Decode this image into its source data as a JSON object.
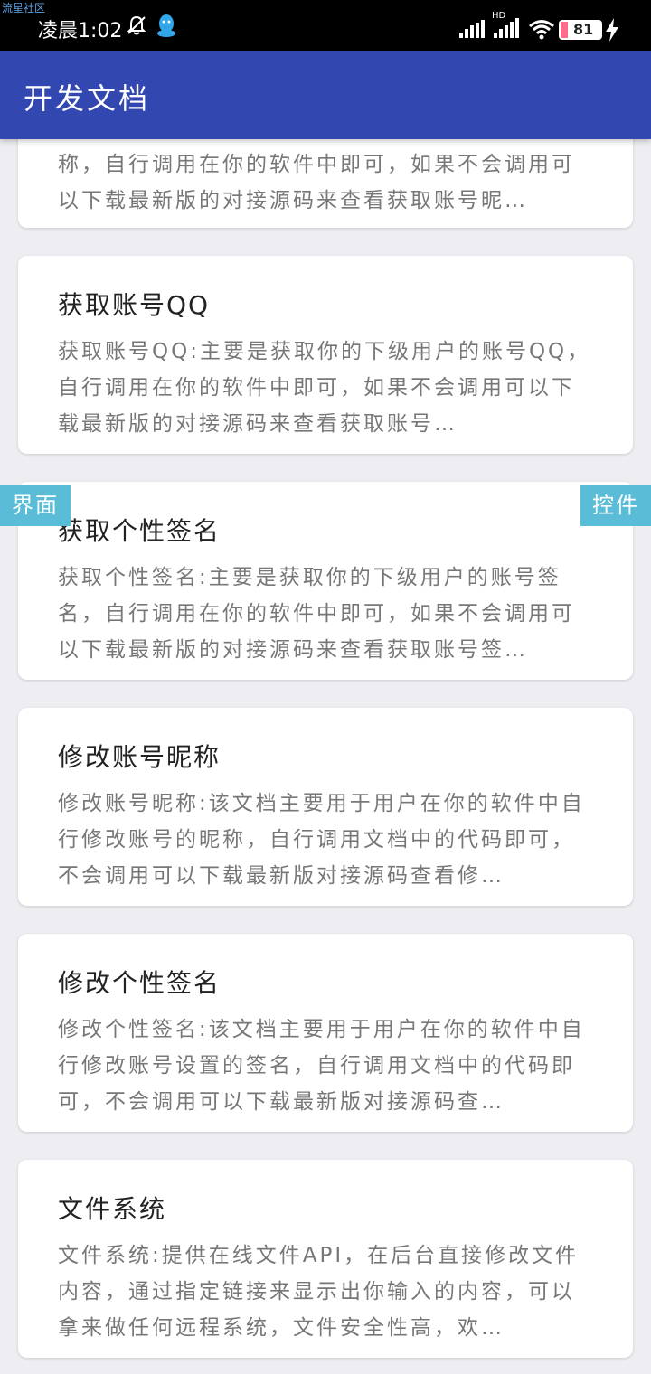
{
  "watermark": "流星社区",
  "status": {
    "time": "凌晨1:02",
    "network_label": "HD",
    "battery_level": "81",
    "icons": [
      "bell-off-icon",
      "qq-icon",
      "signal-icon",
      "hd-signal-icon",
      "wifi-icon",
      "battery-icon",
      "charging-icon"
    ]
  },
  "appbar": {
    "title": "开发文档"
  },
  "cards": [
    {
      "title": "",
      "desc": "称，自行调用在你的软件中即可，如果不会调用可以下载最新版的对接源码来查看获取账号昵…"
    },
    {
      "title": "获取账号QQ",
      "desc": "获取账号QQ:主要是获取你的下级用户的账号QQ，自行调用在你的软件中即可，如果不会调用可以下载最新版的对接源码来查看获取账号…"
    },
    {
      "title": "获取个性签名",
      "desc": "获取个性签名:主要是获取你的下级用户的账号签名，自行调用在你的软件中即可，如果不会调用可以下载最新版的对接源码来查看获取账号签…"
    },
    {
      "title": "修改账号昵称",
      "desc": "修改账号昵称:该文档主要用于用户在你的软件中自行修改账号的昵称，自行调用文档中的代码即可，不会调用可以下载最新版对接源码查看修…"
    },
    {
      "title": "修改个性签名",
      "desc": "修改个性签名:该文档主要用于用户在你的软件中自行修改账号设置的签名，自行调用文档中的代码即可，不会调用可以下载最新版对接源码查…"
    },
    {
      "title": "文件系统",
      "desc": "文件系统:提供在线文件API，在后台直接修改文件内容，通过指定链接来显示出你输入的内容，可以拿来做任何远程系统，文件安全性高，欢…"
    }
  ],
  "side_tabs": {
    "left": "界面",
    "right": "控件"
  },
  "colors": {
    "appbar": "#3347b0",
    "background": "#eeeef2",
    "side_tab": "#5bbcd8"
  }
}
